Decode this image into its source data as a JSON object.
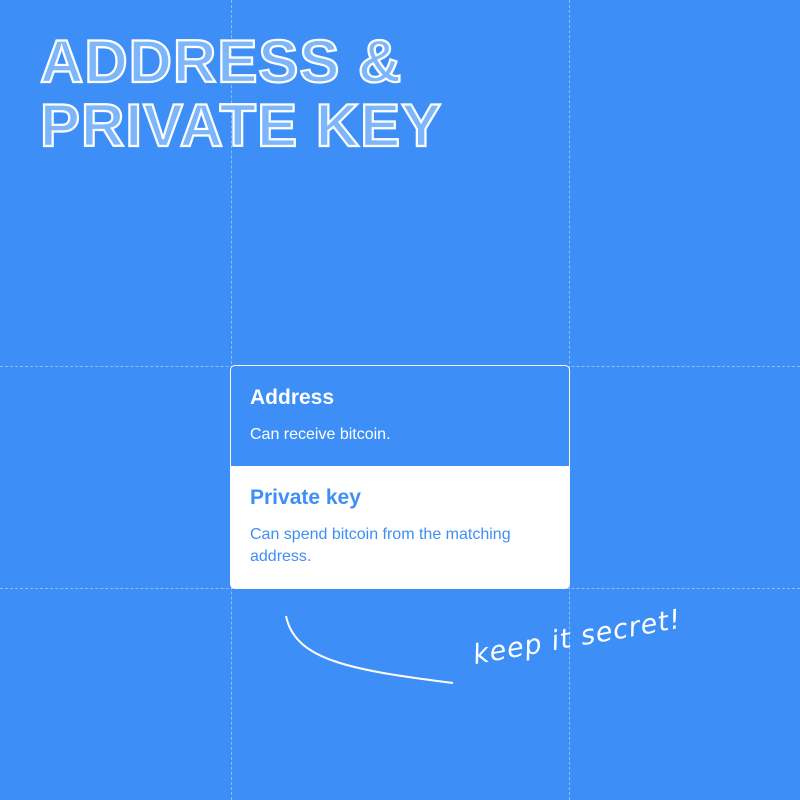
{
  "title": {
    "line1": "ADDRESS &",
    "line2": "PRIVATE KEY"
  },
  "card": {
    "address": {
      "heading": "Address",
      "text": "Can receive bitcoin."
    },
    "private_key": {
      "heading": "Private key",
      "text": "Can spend bitcoin from the matching address."
    }
  },
  "annotation": "keep it secret!",
  "colors": {
    "background": "#3d8ff7",
    "foreground": "#ffffff"
  }
}
